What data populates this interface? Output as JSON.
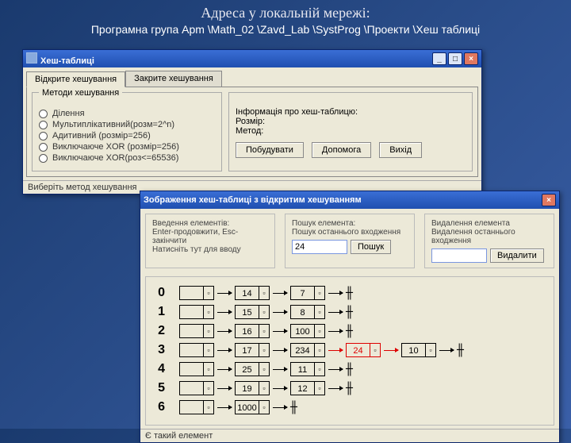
{
  "heading": "Адреса у локальній мережі:",
  "subheading": "Програмна група Apm \\Math_02 \\Zavd_Lab \\SystProg \\Проекти \\Хеш таблиці",
  "win1": {
    "title": "Хеш-таблиці",
    "tabs": {
      "open": "Відкрите хешування",
      "closed": "Закрите хешування"
    },
    "methods": {
      "legend": "Методи хешування",
      "items": [
        "Ділення",
        "Мультиплікативний(розм=2^n)",
        "Адитивний (розмір=256)",
        "Виключаюче XOR (розмір=256)",
        "Виключаюче XOR(роз<=65536)"
      ]
    },
    "info": {
      "legend": "Інформація про хеш-таблицю:",
      "size": "Розмір:",
      "method": "Метод:"
    },
    "buttons": {
      "build": "Побудувати",
      "help": "Допомога",
      "exit": "Вихід"
    },
    "status": "Виберіть метод хешування"
  },
  "win2": {
    "title": "Зображення хеш-таблиці з відкритим хешуванням",
    "insert": {
      "legend": "Введення елементів:",
      "hint1": "Enter-продовжити, Esc-закінчити",
      "hint2": "Натисніть тут для вводу"
    },
    "search": {
      "legend": "Пошук елемента:",
      "hint": "Пошук останнього входження",
      "value": "24",
      "btn": "Пошук"
    },
    "delete": {
      "legend": "Видалення елемента",
      "hint": "Видалення останнього входження",
      "btn": "Видалити"
    },
    "indices": [
      "0",
      "1",
      "2",
      "3",
      "4",
      "5",
      "6"
    ],
    "term": "╫",
    "chains": [
      [
        "14",
        "7"
      ],
      [
        "15",
        "8"
      ],
      [
        "16",
        "100"
      ],
      [
        "17",
        "234",
        "24",
        "10"
      ],
      [
        "25",
        "11"
      ],
      [
        "19",
        "12"
      ],
      [
        "1000"
      ]
    ],
    "status": "Є такий елемент"
  }
}
